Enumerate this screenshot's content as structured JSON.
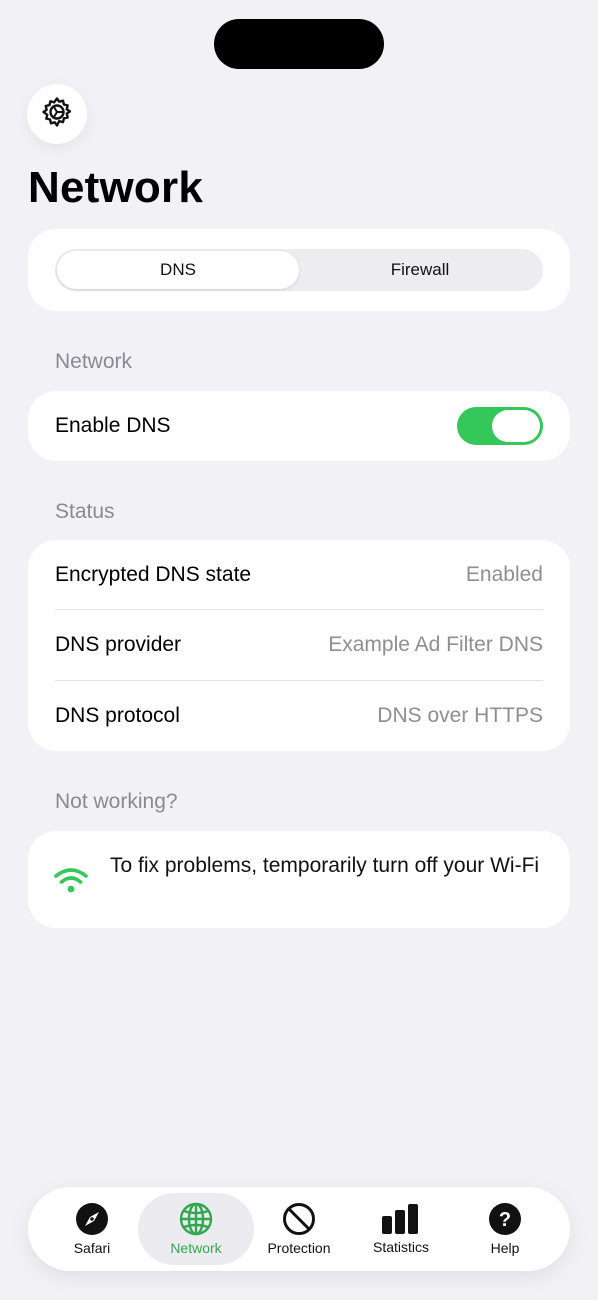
{
  "header": {
    "title": "Network",
    "settings_icon": "gear-icon"
  },
  "segmented": {
    "tabs": [
      {
        "label": "DNS",
        "selected": true
      },
      {
        "label": "Firewall",
        "selected": false
      }
    ]
  },
  "network_section": {
    "label": "Network",
    "enable_dns_label": "Enable DNS",
    "enable_dns_on": true
  },
  "status_section": {
    "label": "Status",
    "rows": [
      {
        "label": "Encrypted DNS state",
        "value": "Enabled"
      },
      {
        "label": "DNS provider",
        "value": "Example Ad Filter DNS"
      },
      {
        "label": "DNS protocol",
        "value": "DNS over HTTPS"
      }
    ]
  },
  "not_working_section": {
    "label": "Not working?",
    "message": "To fix problems, temporarily turn off your Wi-Fi",
    "icon": "wifi-icon"
  },
  "tabbar": {
    "items": [
      {
        "label": "Safari",
        "icon": "compass-icon",
        "active": false
      },
      {
        "label": "Network",
        "icon": "globe-icon",
        "active": true
      },
      {
        "label": "Protection",
        "icon": "prohibit-icon",
        "active": false
      },
      {
        "label": "Statistics",
        "icon": "bar-chart-icon",
        "active": false
      },
      {
        "label": "Help",
        "icon": "question-icon",
        "active": false
      }
    ]
  },
  "colors": {
    "accent_green": "#34c759",
    "active_tab_green": "#2fa84f",
    "background": "#f1f1f6",
    "secondary_text": "#8e8e93"
  }
}
